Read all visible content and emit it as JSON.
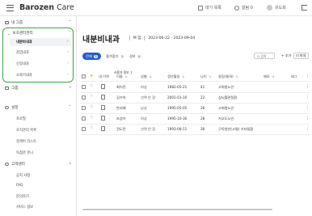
{
  "topbar": {
    "brand_main": "Barozen",
    "brand_sub": "Care",
    "print_label": "대기 목록",
    "alarm_label": "알림 0",
    "user_label": "유도희"
  },
  "sidebar": {
    "groups": [
      {
        "label": "내 그룹",
        "chevron": "^"
      },
      {
        "label": "보호센터관리",
        "chevron": "^"
      },
      {
        "label": "그룹",
        "chevron": "v"
      },
      {
        "label": "설정",
        "chevron": "^"
      },
      {
        "label": "고객센터",
        "chevron": "v"
      }
    ],
    "items": [
      {
        "label": "내분비내과",
        "arrow": "›",
        "active": true
      },
      {
        "label": "감염내과",
        "arrow": "›"
      },
      {
        "label": "신장내과",
        "arrow": "›"
      },
      {
        "label": "소화기내과",
        "arrow": "›"
      }
    ],
    "settings_items": [
      "프로필",
      "조직관리 목록",
      "검색어 리스트",
      "독점관 유니"
    ],
    "support_items": [
      "공지 사항",
      "FAQ",
      "문의하기",
      "서비스 정보"
    ]
  },
  "main": {
    "title": "내분비내과",
    "ward_label": "M 임",
    "date_range": "2023-06-22 - 2023-09-04",
    "filters": {
      "all_label": "전체",
      "all_count": "5",
      "fav_label": "즐겨찾기",
      "fav_count": "2",
      "risk_label": "경보",
      "risk_count": "0"
    },
    "search_placeholder": "Q 검색",
    "add_label": "+ 추가",
    "download_label": "⊡ 파일"
  },
  "table": {
    "group_header": "사용자 정보 ↕",
    "columns": [
      "내 이력",
      "이름",
      "성별",
      "생년월일",
      "나이",
      "알림(통화)",
      "메모",
      "태그"
    ],
    "rows": [
      {
        "name": "최이진",
        "gender": "여성",
        "birth": "1982-05-21",
        "age": "41",
        "alert": "고위험노인",
        "starred": true
      },
      {
        "name": "김수아",
        "gender": "선택 안 함",
        "birth": "2001-01-10",
        "age": "22",
        "alert": "심뇌혈관질환",
        "starred": false
      },
      {
        "name": "반서해",
        "gender": "남성",
        "birth": "1995-05-05",
        "age": "26",
        "alert": "고위험노인",
        "starred": false
      },
      {
        "name": "조섬이",
        "gender": "여성",
        "birth": "1995-10-30",
        "age": "28",
        "alert": "저고도노인",
        "starred": false
      },
      {
        "name": "전도민",
        "gender": "선택 안 함",
        "birth": "1993-08-11",
        "age": "30",
        "alert": "구독청년(고령) 기타질환",
        "starred": false
      }
    ]
  },
  "colors": {
    "accent": "#1e5bd6",
    "highlight_box": "#3ba63f",
    "star_filled": "#f2b200"
  }
}
